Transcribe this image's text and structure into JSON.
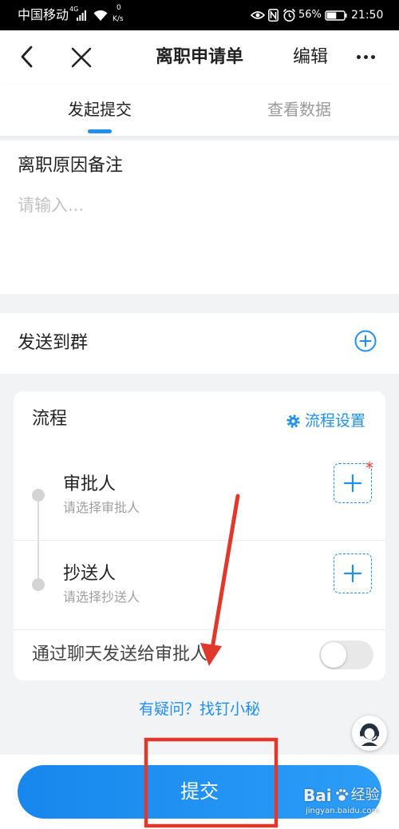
{
  "status_bar": {
    "carrier": "中国移动",
    "network_type": "4G",
    "speed_value": "0",
    "speed_unit": "K/s",
    "battery_text": "56%",
    "battery_level": 0.56,
    "time": "21:50",
    "icons": [
      "signal-icon",
      "wifi-icon",
      "eye-comfort-icon",
      "nfc-icon",
      "alarm-icon",
      "battery-icon"
    ]
  },
  "header": {
    "title": "离职申请单",
    "edit_label": "编辑",
    "icons": {
      "back": "chevron-left-icon",
      "close": "close-icon",
      "more": "more-dots-icon"
    }
  },
  "tabs": [
    {
      "label": "发起提交",
      "active": true
    },
    {
      "label": "查看数据",
      "active": false
    }
  ],
  "remark": {
    "label": "离职原因备注",
    "placeholder": "请输入..."
  },
  "send_to_group": {
    "label": "发送到群",
    "icon": "plus-circle-icon"
  },
  "process": {
    "title": "流程",
    "settings_label": "流程设置",
    "settings_icon": "gear-icon",
    "approver": {
      "label": "审批人",
      "hint": "请选择审批人",
      "required_mark": "*"
    },
    "cc": {
      "label": "抄送人",
      "hint": "请选择抄送人"
    },
    "chat_notify": {
      "label": "通过聊天发送给审批人",
      "enabled": false
    }
  },
  "help_link": "有疑问？找钉小秘",
  "support_icon": "customer-service-icon",
  "submit_label": "提交",
  "watermark": {
    "brand": "Bai",
    "product": "经验",
    "url": "jingyan.baidu.com"
  },
  "colors": {
    "accent": "#1f8ff0",
    "annotation": "#e0392b",
    "required": "#f04134",
    "page_background": "#f2f3f5",
    "toggle_off": "#e8e8e8"
  }
}
